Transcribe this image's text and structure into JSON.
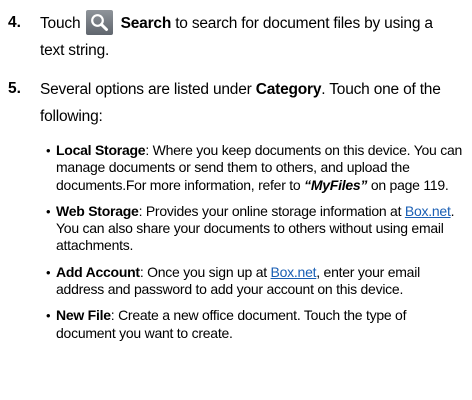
{
  "steps": [
    {
      "number": "4.",
      "text_before": "Touch",
      "icon": "search-icon",
      "bold_label": "Search",
      "text_after": " to search for document files by using a",
      "text_line2": "text string."
    },
    {
      "number": "5.",
      "text_before": "Several options are listed under ",
      "bold_label": "Category",
      "text_after": ". Touch one of the",
      "text_line2": "following:"
    }
  ],
  "bullets": [
    {
      "label": "Local Storage",
      "text": ": Where you keep documents on this device. You can manage documents or send them to others, and upload the documents.For more information, refer to ",
      "ref": "“MyFiles”",
      "text_end": "  on page 119."
    },
    {
      "label": "Web Storage",
      "text": ": Provides your online storage information at ",
      "link": "Box.net",
      "text_end": ". You can also share your documents to others without using email attachments."
    },
    {
      "label": "Add Account",
      "text": ": Once you sign up at ",
      "link": "Box.net",
      "text_end": ", enter your email address and password to add your account on this device."
    },
    {
      "label": "New File",
      "text": ": Create a new office document. Touch the type of document you want to create."
    }
  ],
  "bullet_glyph": "•",
  "colors": {
    "link": "#1a5fb4",
    "icon_bg": "#6f757c"
  }
}
